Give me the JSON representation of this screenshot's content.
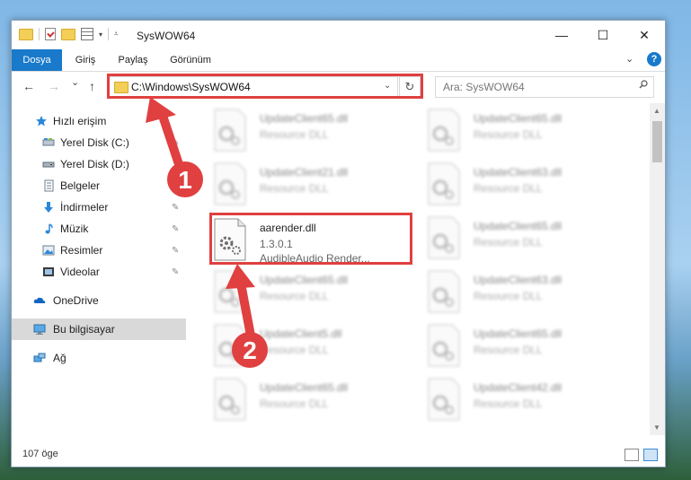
{
  "window": {
    "title": "SysWOW64",
    "controls": {
      "minimize": "—",
      "maximize": "☐",
      "close": "✕"
    }
  },
  "ribbon": {
    "tabs": [
      {
        "label": "Dosya",
        "active": true
      },
      {
        "label": "Giriş",
        "active": false
      },
      {
        "label": "Paylaş",
        "active": false
      },
      {
        "label": "Görünüm",
        "active": false
      }
    ],
    "help": "?"
  },
  "nav": {
    "back": "←",
    "forward": "→",
    "recent": "⌄",
    "up": "↑",
    "address": "C:\\Windows\\SysWOW64",
    "refresh": "↻",
    "search_placeholder": "Ara: SysWOW64"
  },
  "sidebar": {
    "items": [
      {
        "label": "Hızlı erişim",
        "icon": "star-icon",
        "pinned": false
      },
      {
        "label": "Yerel Disk (C:)",
        "icon": "drive-icon",
        "pinned": true
      },
      {
        "label": "Yerel Disk (D:)",
        "icon": "drive-icon",
        "pinned": false
      },
      {
        "label": "Belgeler",
        "icon": "documents-icon",
        "pinned": true
      },
      {
        "label": "İndirmeler",
        "icon": "download-icon",
        "pinned": true
      },
      {
        "label": "Müzik",
        "icon": "music-icon",
        "pinned": true
      },
      {
        "label": "Resimler",
        "icon": "pictures-icon",
        "pinned": true
      },
      {
        "label": "Videolar",
        "icon": "video-icon",
        "pinned": true
      },
      {
        "label": "OneDrive",
        "icon": "cloud-icon",
        "pinned": false
      },
      {
        "label": "Bu bilgisayar",
        "icon": "computer-icon",
        "pinned": false,
        "selected": true
      },
      {
        "label": "Ağ",
        "icon": "network-icon",
        "pinned": false
      }
    ],
    "pin_glyph": "📌"
  },
  "files": {
    "highlighted": {
      "name": "aarender.dll",
      "version": "1.3.0.1",
      "description": "AudibleAudio Render..."
    },
    "left_column": [
      {
        "name": "UpdateClient65.dll",
        "type": "Resource DLL"
      },
      {
        "name": "UpdateClient21.dll",
        "type": "Resource DLL"
      },
      null,
      {
        "name": "UpdateClient65.dll",
        "type": "Resource DLL"
      },
      {
        "name": "UpdateClient5.dll",
        "type": "Resource DLL"
      },
      {
        "name": "UpdateClient65.dll",
        "type": "Resource DLL"
      }
    ],
    "right_column": [
      {
        "name": "UpdateClient65.dll",
        "type": "Resource DLL"
      },
      {
        "name": "UpdateClient63.dll",
        "type": "Resource DLL"
      },
      {
        "name": "UpdateClient65.dll",
        "type": "Resource DLL"
      },
      {
        "name": "UpdateClient63.dll",
        "type": "Resource DLL"
      },
      {
        "name": "UpdateClient65.dll",
        "type": "Resource DLL"
      },
      {
        "name": "UpdateClient42.dll",
        "type": "Resource DLL"
      }
    ]
  },
  "status": {
    "count": "107 öge"
  },
  "annotations": {
    "step1": "1",
    "step2": "2",
    "color": "#e04040"
  }
}
